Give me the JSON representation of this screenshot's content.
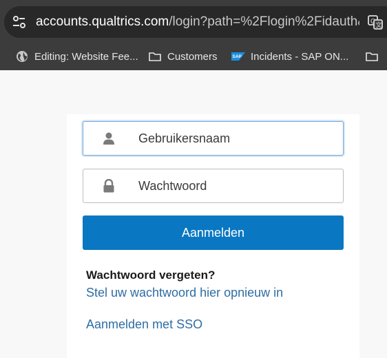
{
  "browser": {
    "url_host": "accounts.qualtrics.com",
    "url_path": "/login?path=%2Flogin%2Fidauth&c...",
    "bookmarks": [
      {
        "label": "Editing: Website Fee...",
        "icon": "globe-icon"
      },
      {
        "label": "Customers",
        "icon": "folder-icon"
      },
      {
        "label": "Incidents - SAP ON...",
        "icon": "sap-logo-icon"
      },
      {
        "label": "",
        "icon": "folder-icon"
      }
    ]
  },
  "login": {
    "username_placeholder": "Gebruikersnaam",
    "password_placeholder": "Wachtwoord",
    "submit_label": "Aanmelden",
    "forgot_title": "Wachtwoord vergeten?",
    "reset_link": "Stel uw wachtwoord hier opnieuw in",
    "sso_link": "Aanmelden met SSO"
  },
  "colors": {
    "primary_button": "#0a77c2",
    "link": "#2e6da4",
    "focus_border": "#74a9d8"
  }
}
